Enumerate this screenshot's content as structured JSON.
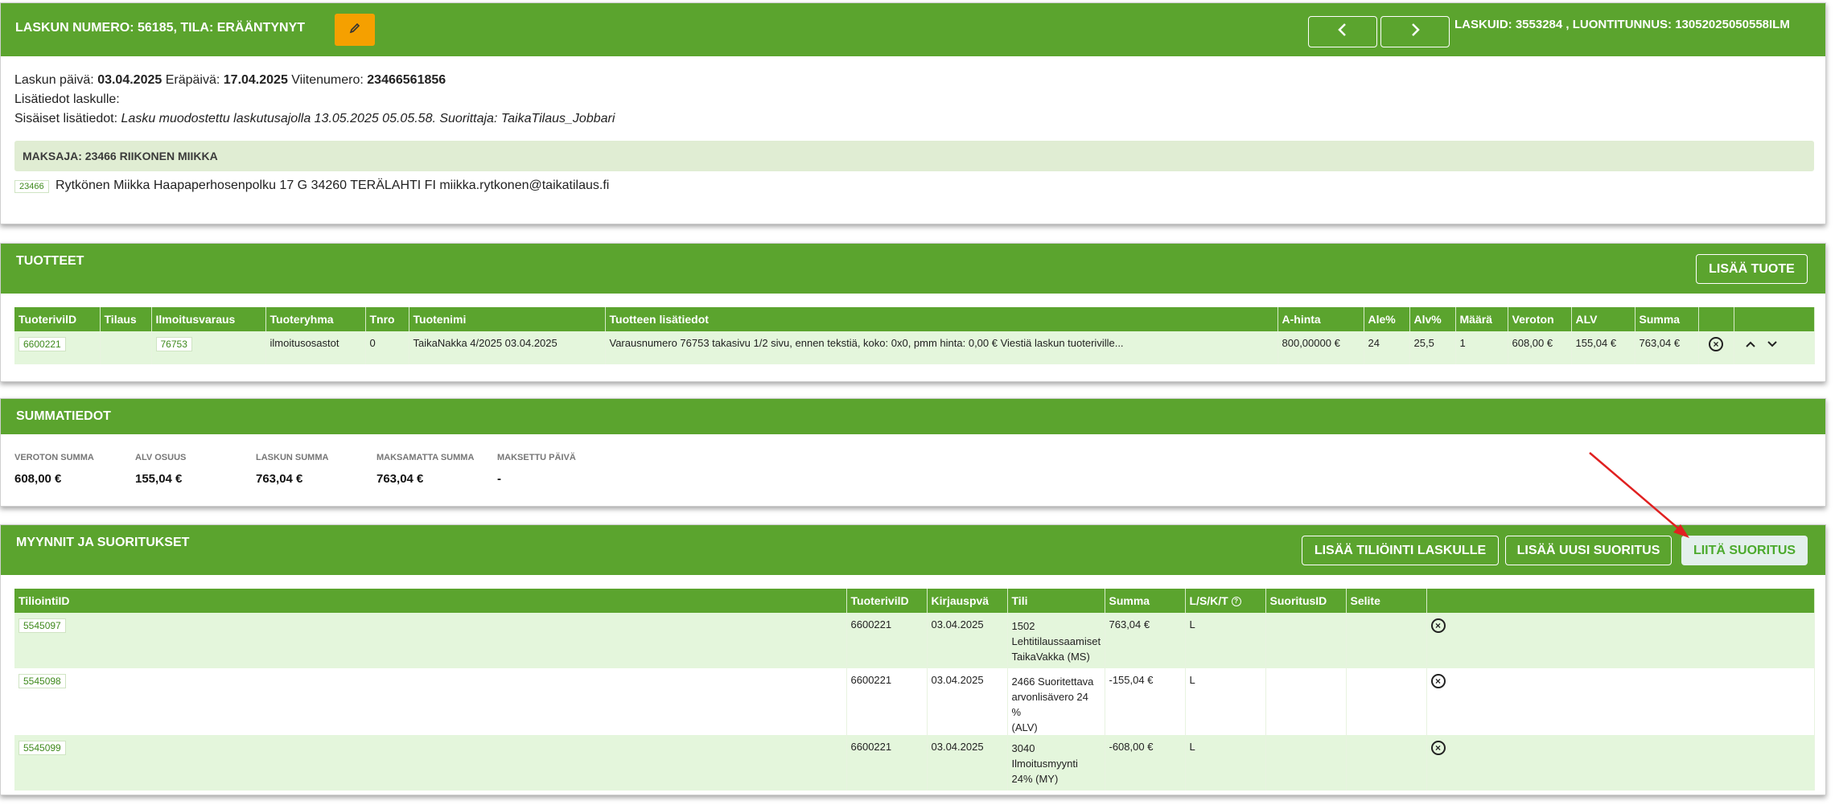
{
  "header": {
    "label_invoice": "LASKUN NUMERO:",
    "invoice_number": "56185",
    "label_status": ", TILA:",
    "status": "ERÄÄNTYNYT",
    "ids_text": "LASKUID: 3553284 , LUONTITUNNUS: 13052025050558ILM"
  },
  "details": {
    "date_label": "Laskun päivä:",
    "date": "03.04.2025",
    "due_label": "Eräpäivä:",
    "due": "17.04.2025",
    "ref_label": "Viitenumero:",
    "ref": "23466561856",
    "extra_label": "Lisätiedot laskulle:",
    "internal_label": "Sisäiset lisätiedot:",
    "internal_text": "Lasku muodostettu laskutusajolla 13.05.2025 05.05.58. Suorittaja: TaikaTilaus_Jobbari"
  },
  "payer": {
    "label": "MAKSAJA:",
    "name": "23466 RIIKONEN MIIKKA",
    "id": "23466",
    "address": "Rytkönen Miikka Haapaperhosenpolku 17 G 34260 TERÄLAHTI FI miikka.rytkonen@taikatilaus.fi"
  },
  "products": {
    "title": "TUOTTEET",
    "add_button": "LISÄÄ TUOTE",
    "columns": [
      "TuoterivilD",
      "Tilaus",
      "Ilmoitusvaraus",
      "Tuoteryhma",
      "Tnro",
      "Tuotenimi",
      "Tuotteen lisätiedot",
      "A-hinta",
      "Ale%",
      "Alv%",
      "Määrä",
      "Veroton",
      "ALV",
      "Summa"
    ],
    "row": {
      "id": "6600221",
      "order": "",
      "reservation": "76753",
      "group": "ilmoitusosastot",
      "tnro": "0",
      "name": "TaikaNakka 4/2025 03.04.2025",
      "info": "Varausnumero 76753 takasivu 1/2 sivu, ennen tekstiä, koko: 0x0, pmm hinta: 0,00 € Viestiä laskun tuoteriville...",
      "price": "800,00000 €",
      "discount": "24",
      "vat_pct": "25,5",
      "qty": "1",
      "net": "608,00 €",
      "vat": "155,04 €",
      "total": "763,04 €"
    }
  },
  "summary": {
    "title": "SUMMATIEDOT",
    "items": [
      {
        "label": "VEROTON SUMMA",
        "value": "608,00 €"
      },
      {
        "label": "ALV OSUUS",
        "value": "155,04 €"
      },
      {
        "label": "LASKUN SUMMA",
        "value": "763,04 €"
      },
      {
        "label": "MAKSAMATTA SUMMA",
        "value": "763,04 €"
      },
      {
        "label": "MAKSETTU PÄIVÄ",
        "value": "-"
      }
    ]
  },
  "sales": {
    "title": "MYYNNIT JA SUORITUKSET",
    "btn_add_posting": "LISÄÄ TILIÖINTI LASKULLE",
    "btn_add_payment": "LISÄÄ UUSI SUORITUS",
    "btn_attach_payment": "LIITÄ SUORITUS",
    "columns": [
      "TiliointiID",
      "TuoterivilD",
      "Kirjauspvä",
      "Tili",
      "Summa",
      "L/S/K/T",
      "SuoritusID",
      "Selite"
    ],
    "rows": [
      {
        "id": "5545097",
        "product_row": "6600221",
        "date": "03.04.2025",
        "account_l1": "1502",
        "account_l2": "Lehtitilaussaamiset",
        "account_l3": "TaikaVakka (MS)",
        "sum": "763,04 €",
        "type": "L"
      },
      {
        "id": "5545098",
        "product_row": "6600221",
        "date": "03.04.2025",
        "account_l1": "2466 Suoritettava",
        "account_l2": "arvonlisävero 24 %",
        "account_l3": "(ALV)",
        "sum": "-155,04 €",
        "type": "L"
      },
      {
        "id": "5545099",
        "product_row": "6600221",
        "date": "03.04.2025",
        "account_l1": "3040",
        "account_l2": "Ilmoitusmyynti",
        "account_l3": "24% (MY)",
        "sum": "-608,00 €",
        "type": "L"
      }
    ]
  },
  "colors": {
    "brand": "#5ba42e",
    "payer_band": "#e0edd3",
    "row_bg": "#e4f6dc",
    "edit_button": "#f5a000",
    "arrow": "#e02020"
  }
}
